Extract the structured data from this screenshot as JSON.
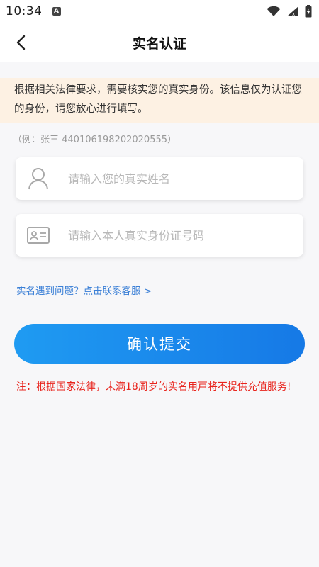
{
  "status_bar": {
    "time": "10:34",
    "notification_icon": "A"
  },
  "header": {
    "title": "实名认证",
    "back_icon": "chevron-left-icon"
  },
  "notice": {
    "text": "根据相关法律要求，需要核实您的真实身份。该信息仅为认证您的身份，请您放心进行填写。",
    "background": "#fdf1e3"
  },
  "example": {
    "text": "（例：张三 440106198202020555）"
  },
  "form": {
    "name_placeholder": "请输入您的真实姓名",
    "name_value": "",
    "id_placeholder": "请输入本人真实身份证号码",
    "id_value": ""
  },
  "help_link": {
    "text": "实名遇到问题？点击联系客服 >"
  },
  "submit": {
    "label": "确认提交"
  },
  "warning": {
    "text": "注：根据国家法律，未满18周岁的实名用戸将不提供充值服务!"
  },
  "colors": {
    "accent": "#1679e6",
    "warning": "#e8231c",
    "link": "#3a7fd6"
  }
}
